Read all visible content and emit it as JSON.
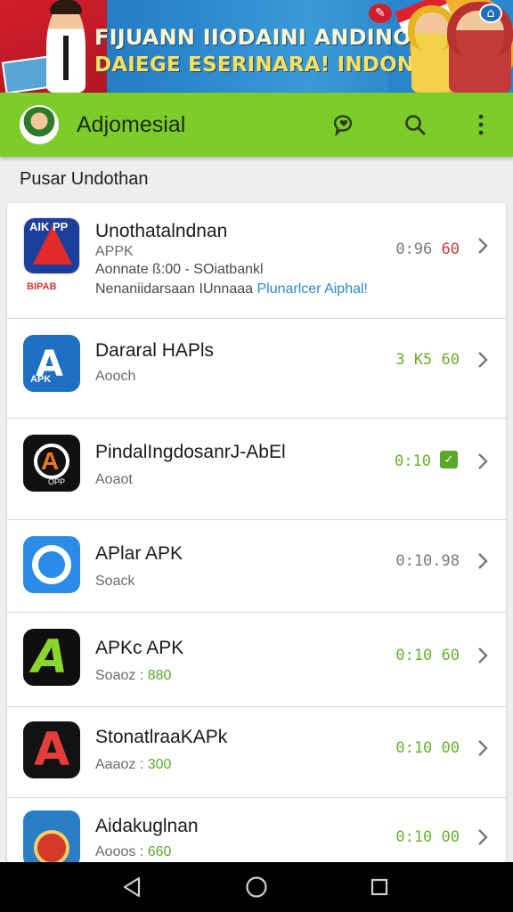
{
  "banner": {
    "line1": "FIJUANN IIODAINI ANDINOIRAM",
    "line2": "DAIEGE ESERINARA! INDONGSDAI"
  },
  "appbar": {
    "title": "Adjomesial"
  },
  "section": {
    "title": "Pusar Undothan"
  },
  "items": [
    {
      "name": "Unothatalndnan",
      "sub": "APPK",
      "line1": "Aonnate ß:00 - SOiatbankl",
      "line2_a": "Nenaniidarsaan IUnnaaa ",
      "line2_b": "Plunarlcer Aiphal!",
      "meta_a": "0:96 ",
      "meta_b": "60",
      "icon_text": "AIK PP",
      "icon_text2": "BIPAB"
    },
    {
      "name": "Dararal HAPls",
      "sub": "Aooch",
      "meta": "3 K5 60",
      "icon_text": "APK"
    },
    {
      "name": "PindalIngdosanrJ-AbEl",
      "sub": "Aoaot",
      "meta": "0:10",
      "icon_text": "OPP"
    },
    {
      "name": "APlar APK",
      "sub": "Soack",
      "meta": "0:10.98"
    },
    {
      "name": "APKc APK",
      "sub_a": "Soaoz : ",
      "sub_b": "880",
      "meta": "0:10 60"
    },
    {
      "name": "StonatlraaKAPk",
      "sub_a": "Aaaoz : ",
      "sub_b": "300",
      "meta": "0:10 00"
    },
    {
      "name": "Aidakuglnan",
      "sub_a": "Aooos : ",
      "sub_b": "660",
      "meta": "0:10 00"
    }
  ],
  "icons": {
    "chat": "chat-heart-icon",
    "search": "search-icon",
    "more": "more-vertical-icon",
    "chevron": "chevron-right-icon",
    "back": "nav-back-icon",
    "home": "nav-home-icon",
    "recent": "nav-recent-icon"
  },
  "colors": {
    "appbar": "#7ccd2a",
    "accent_green": "#6aae2c",
    "link_blue": "#2c88d4",
    "banner_blue": "#1f6fb8",
    "banner_red": "#d21e2b"
  }
}
